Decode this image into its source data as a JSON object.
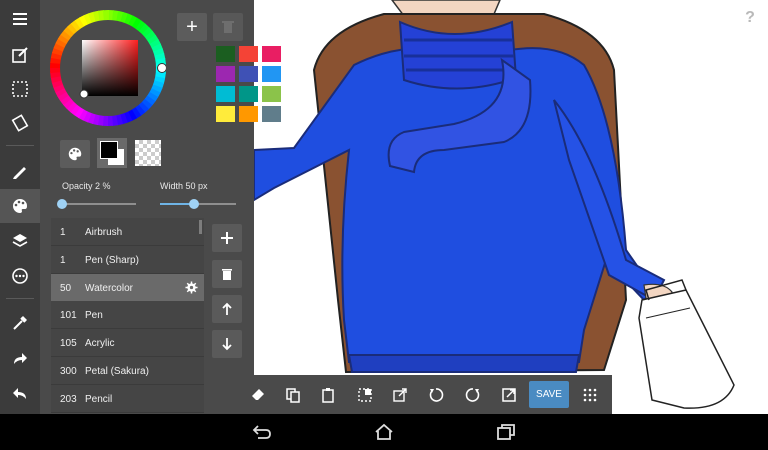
{
  "colors": {
    "accent": "#4a8bc2",
    "panel_bg": "#4a4a4a",
    "toolbar_bg": "#3b3b3b"
  },
  "palette": {
    "add_label": "+",
    "swatches": [
      "#1b5e20",
      "#f44336",
      "#e91e63",
      "#9c27b0",
      "#3f51b5",
      "#2196f3",
      "#00bcd4",
      "#009688",
      "#8bc34a",
      "#ffeb3b",
      "#ff9800",
      "#607d8b"
    ]
  },
  "sliders": {
    "opacity_label": "Opacity 2 %",
    "opacity_value": 0.02,
    "width_label": "Width 50 px",
    "width_value": 0.45
  },
  "brushes": [
    {
      "size": "1",
      "name": "Airbrush"
    },
    {
      "size": "1",
      "name": "Pen (Sharp)"
    },
    {
      "size": "50",
      "name": "Watercolor",
      "selected": true
    },
    {
      "size": "101",
      "name": "Pen"
    },
    {
      "size": "105",
      "name": "Acrylic"
    },
    {
      "size": "300",
      "name": "Petal (Sakura)"
    },
    {
      "size": "203",
      "name": "Pencil"
    }
  ],
  "left_tools": [
    "menu-icon",
    "edit-canvas-icon",
    "selection-icon",
    "transform-icon",
    "pen-icon",
    "palette-icon",
    "layers-icon",
    "more-options-icon",
    "eyedropper-icon",
    "redo-icon",
    "undo-icon"
  ],
  "bottom_tools": [
    "eraser-icon",
    "copy-icon",
    "paste-icon",
    "select-layer-icon",
    "export-icon",
    "rotate-left-icon",
    "rotate-right-icon",
    "open-external-icon"
  ],
  "bottom_toolbar": {
    "save_label": "SAVE"
  },
  "help_label": "?",
  "nav": [
    "back-icon",
    "home-icon",
    "recents-icon"
  ]
}
